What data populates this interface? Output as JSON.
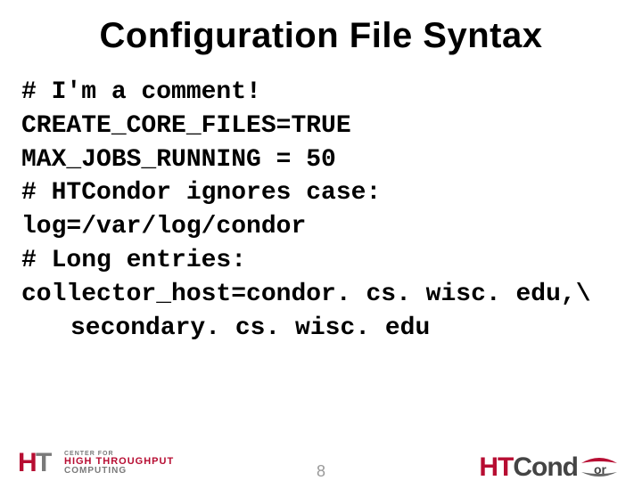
{
  "title": "Configuration File Syntax",
  "code": {
    "l1": "# I'm a comment!",
    "l2": "CREATE_CORE_FILES=TRUE",
    "l3": "MAX_JOBS_RUNNING = 50",
    "l4": "# HTCondor ignores case:",
    "l5": "log=/var/log/condor",
    "l6": "# Long entries:",
    "l7": "collector_host=condor. cs. wisc. edu,\\",
    "l8": "secondary. cs. wisc. edu"
  },
  "footer": {
    "page_number": "8",
    "left_logo": {
      "line1": "CENTER FOR",
      "line2": "HIGH THROUGHPUT",
      "line3": "COMPUTING"
    },
    "right_logo": {
      "prefix": "HT",
      "suffix": "Cond"
    }
  }
}
